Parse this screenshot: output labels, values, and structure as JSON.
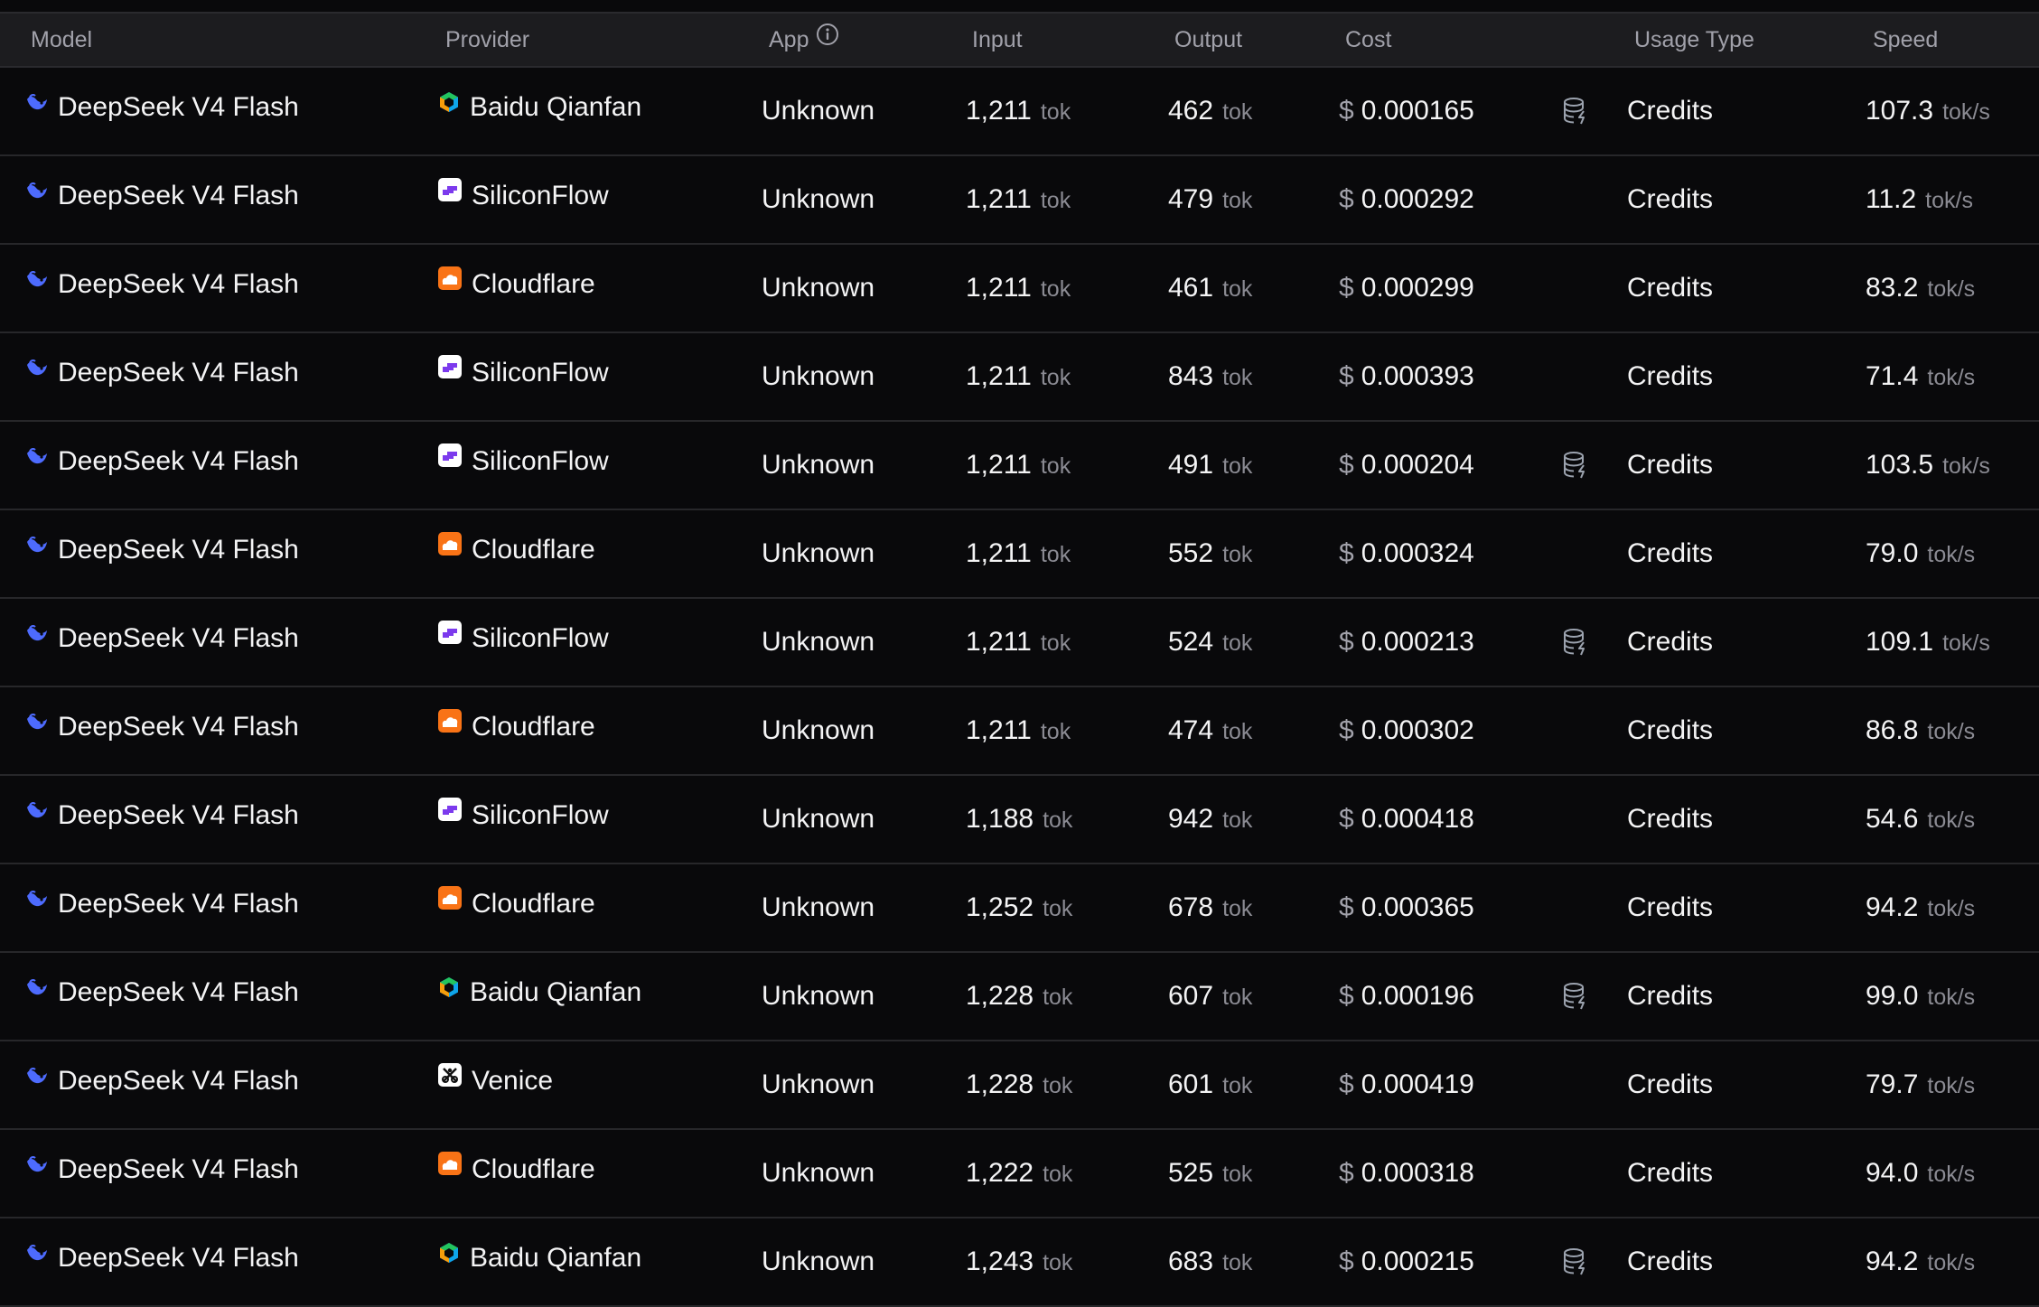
{
  "header": {
    "model": "Model",
    "provider": "Provider",
    "app": "App",
    "input": "Input",
    "output": "Output",
    "cost": "Cost",
    "usage_type": "Usage Type",
    "speed": "Speed"
  },
  "units": {
    "tok": "tok",
    "speed": "tok/s",
    "currency": "$"
  },
  "colors": {
    "background": "#09090b",
    "header_bg": "#1c1c1f",
    "deepseek_blue": "#4d6bfe",
    "siliconflow_purple": "#7c3aed",
    "cloudflare_orange": "#f97316"
  },
  "rows": [
    {
      "model": "DeepSeek V4 Flash",
      "provider": "Baidu Qianfan",
      "provider_icon": "baidu-qianfan-icon",
      "app": "Unknown",
      "input": "1,211",
      "output": "462",
      "cost": "0.000165",
      "cache": true,
      "usage": "Credits",
      "speed": "107.3"
    },
    {
      "model": "DeepSeek V4 Flash",
      "provider": "SiliconFlow",
      "provider_icon": "siliconflow-icon",
      "app": "Unknown",
      "input": "1,211",
      "output": "479",
      "cost": "0.000292",
      "cache": false,
      "usage": "Credits",
      "speed": "11.2"
    },
    {
      "model": "DeepSeek V4 Flash",
      "provider": "Cloudflare",
      "provider_icon": "cloudflare-icon",
      "app": "Unknown",
      "input": "1,211",
      "output": "461",
      "cost": "0.000299",
      "cache": false,
      "usage": "Credits",
      "speed": "83.2"
    },
    {
      "model": "DeepSeek V4 Flash",
      "provider": "SiliconFlow",
      "provider_icon": "siliconflow-icon",
      "app": "Unknown",
      "input": "1,211",
      "output": "843",
      "cost": "0.000393",
      "cache": false,
      "usage": "Credits",
      "speed": "71.4"
    },
    {
      "model": "DeepSeek V4 Flash",
      "provider": "SiliconFlow",
      "provider_icon": "siliconflow-icon",
      "app": "Unknown",
      "input": "1,211",
      "output": "491",
      "cost": "0.000204",
      "cache": true,
      "usage": "Credits",
      "speed": "103.5"
    },
    {
      "model": "DeepSeek V4 Flash",
      "provider": "Cloudflare",
      "provider_icon": "cloudflare-icon",
      "app": "Unknown",
      "input": "1,211",
      "output": "552",
      "cost": "0.000324",
      "cache": false,
      "usage": "Credits",
      "speed": "79.0"
    },
    {
      "model": "DeepSeek V4 Flash",
      "provider": "SiliconFlow",
      "provider_icon": "siliconflow-icon",
      "app": "Unknown",
      "input": "1,211",
      "output": "524",
      "cost": "0.000213",
      "cache": true,
      "usage": "Credits",
      "speed": "109.1"
    },
    {
      "model": "DeepSeek V4 Flash",
      "provider": "Cloudflare",
      "provider_icon": "cloudflare-icon",
      "app": "Unknown",
      "input": "1,211",
      "output": "474",
      "cost": "0.000302",
      "cache": false,
      "usage": "Credits",
      "speed": "86.8"
    },
    {
      "model": "DeepSeek V4 Flash",
      "provider": "SiliconFlow",
      "provider_icon": "siliconflow-icon",
      "app": "Unknown",
      "input": "1,188",
      "output": "942",
      "cost": "0.000418",
      "cache": false,
      "usage": "Credits",
      "speed": "54.6"
    },
    {
      "model": "DeepSeek V4 Flash",
      "provider": "Cloudflare",
      "provider_icon": "cloudflare-icon",
      "app": "Unknown",
      "input": "1,252",
      "output": "678",
      "cost": "0.000365",
      "cache": false,
      "usage": "Credits",
      "speed": "94.2"
    },
    {
      "model": "DeepSeek V4 Flash",
      "provider": "Baidu Qianfan",
      "provider_icon": "baidu-qianfan-icon",
      "app": "Unknown",
      "input": "1,228",
      "output": "607",
      "cost": "0.000196",
      "cache": true,
      "usage": "Credits",
      "speed": "99.0"
    },
    {
      "model": "DeepSeek V4 Flash",
      "provider": "Venice",
      "provider_icon": "venice-icon",
      "app": "Unknown",
      "input": "1,228",
      "output": "601",
      "cost": "0.000419",
      "cache": false,
      "usage": "Credits",
      "speed": "79.7"
    },
    {
      "model": "DeepSeek V4 Flash",
      "provider": "Cloudflare",
      "provider_icon": "cloudflare-icon",
      "app": "Unknown",
      "input": "1,222",
      "output": "525",
      "cost": "0.000318",
      "cache": false,
      "usage": "Credits",
      "speed": "94.0"
    },
    {
      "model": "DeepSeek V4 Flash",
      "provider": "Baidu Qianfan",
      "provider_icon": "baidu-qianfan-icon",
      "app": "Unknown",
      "input": "1,243",
      "output": "683",
      "cost": "0.000215",
      "cache": true,
      "usage": "Credits",
      "speed": "94.2"
    }
  ]
}
